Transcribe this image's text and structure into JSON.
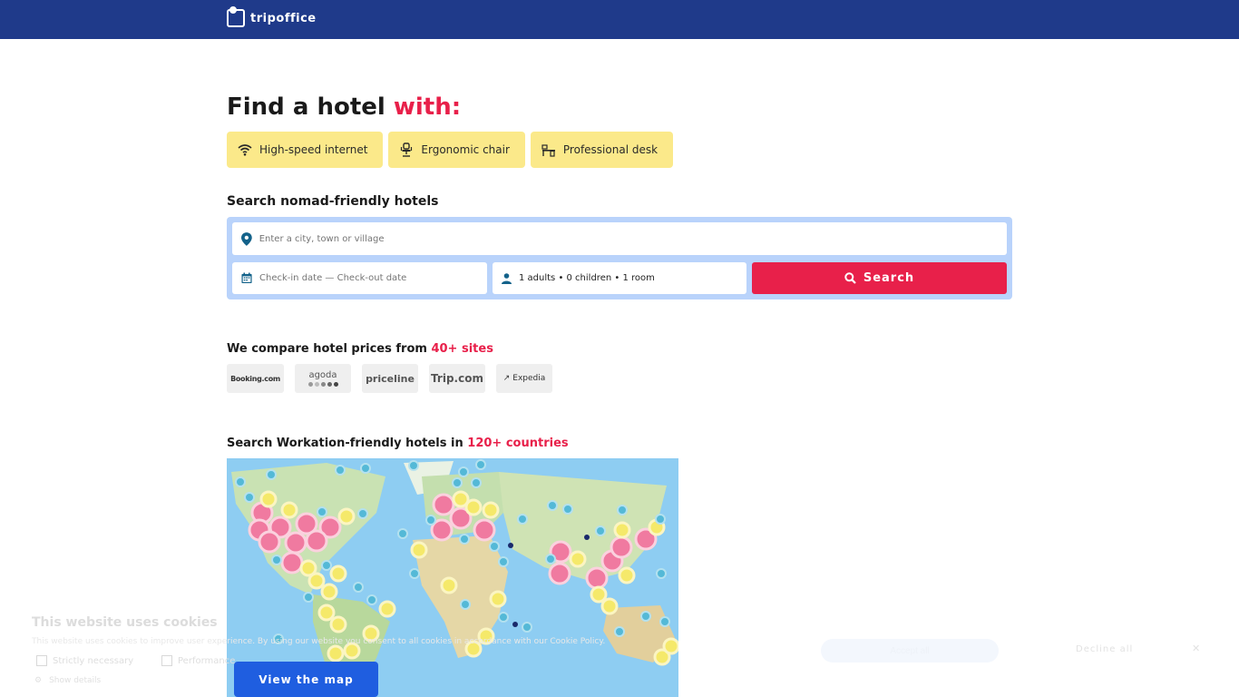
{
  "header": {
    "logo_text": "tripoffice"
  },
  "hero": {
    "title_part1": "Find a hotel ",
    "title_accent": "with:"
  },
  "features": [
    {
      "label": "High-speed internet",
      "icon": "wifi-icon"
    },
    {
      "label": "Ergonomic chair",
      "icon": "chair-icon"
    },
    {
      "label": "Professional desk",
      "icon": "desk-icon"
    }
  ],
  "search": {
    "title": "Search nomad-friendly hotels",
    "destination_placeholder": "Enter a city, town or village",
    "dates_placeholder": "Check-in date — Check-out date",
    "guests_value": "1 adults • 0 children • 1 room",
    "button_label": "Search"
  },
  "compare": {
    "title_part1": "We compare hotel prices from ",
    "title_accent": "40+ sites",
    "partners": [
      "Booking.com",
      "agoda",
      "priceline",
      "Trip.com",
      "Expedia"
    ]
  },
  "map_section": {
    "title_part1": "Search Workation-friendly hotels in ",
    "title_accent": "120+ countries",
    "button_label": "View the map"
  },
  "cookie_banner": {
    "title": "This website uses cookies",
    "description": "This website uses cookies to improve user experience. By using our website you consent to all cookies in accordance with our Cookie Policy.",
    "options": [
      "Strictly necessary",
      "Performance"
    ],
    "show_details": "Show details",
    "accept_label": "Accept all",
    "decline_label": "Decline all",
    "close_icon": "close-icon"
  },
  "colors": {
    "brand": "#1f3a8a",
    "accent": "#e8204a",
    "feature_bg": "#fbe98a",
    "search_bg": "#b9d3fb",
    "map_button": "#1f5ee0"
  }
}
